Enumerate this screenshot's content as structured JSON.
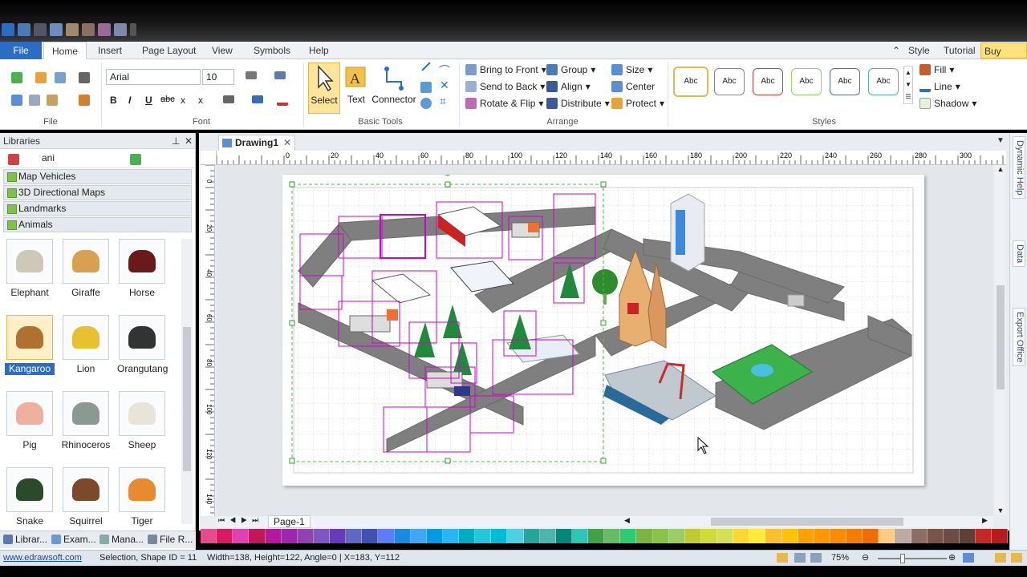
{
  "quick_access_icons": [
    "app-icon",
    "undo-icon",
    "redo-icon",
    "pointer-icon",
    "save-icon",
    "open-icon",
    "print-icon",
    "clipboard-icon",
    "menu-icon"
  ],
  "menu_tabs": {
    "file": "File",
    "home": "Home",
    "insert": "Insert",
    "page_layout": "Page Layout",
    "view": "View",
    "symbols": "Symbols",
    "help": "Help"
  },
  "top_right": {
    "style": "Style",
    "tutorial": "Tutorial",
    "buy_now": "Buy Now"
  },
  "ribbon": {
    "file_group": "File",
    "font": {
      "family": "Arial",
      "size": "10",
      "group": "Font",
      "bold": "B",
      "italic": "I",
      "underline": "U",
      "strike": "abc",
      "sub": "x",
      "sup": "x"
    },
    "basic_tools": {
      "select": "Select",
      "text": "Text",
      "connector": "Connector",
      "group": "Basic Tools"
    },
    "arrange": {
      "bring_to_front": "Bring to Front",
      "send_to_back": "Send to Back",
      "rotate_flip": "Rotate & Flip",
      "group_btn": "Group",
      "align": "Align",
      "distribute": "Distribute",
      "size": "Size",
      "center": "Center",
      "protect": "Protect",
      "group": "Arrange"
    },
    "styles": {
      "sample": "Abc",
      "group": "Styles",
      "fill": "Fill",
      "line": "Line",
      "shadow": "Shadow"
    }
  },
  "libraries": {
    "title": "Libraries",
    "search": "ani",
    "categories": [
      "Map Vehicles",
      "3D Directional Maps",
      "Landmarks",
      "Animals"
    ],
    "animals": [
      "Elephant",
      "Giraffe",
      "Horse",
      "Kangaroo",
      "Lion",
      "Orangutang",
      "Pig",
      "Rhinoceros",
      "Sheep",
      "Snake",
      "Squirrel",
      "Tiger"
    ],
    "selected": "Kangaroo",
    "bottom_tabs": [
      "Librar...",
      "Exam...",
      "Mana...",
      "File R..."
    ]
  },
  "document": {
    "tab": "Drawing1",
    "page": "Page-1",
    "ruler_labels": [
      "0",
      "20",
      "40",
      "60",
      "80",
      "100",
      "120",
      "140",
      "160",
      "180",
      "200",
      "220",
      "240",
      "260",
      "280",
      "300"
    ],
    "vruler_labels": [
      "0",
      "20",
      "40",
      "60",
      "80",
      "100",
      "120",
      "140"
    ]
  },
  "right_panel": [
    "Dynamic Help",
    "Data",
    "Export Office"
  ],
  "status": {
    "url": "www.edrawsoft.com",
    "selection": "Selection, Shape ID = 11",
    "dims": "Width=138, Height=122, Angle=0 | X=183, Y=112",
    "zoom": "75%"
  },
  "palette": [
    "#e84a8a",
    "#d81b60",
    "#e040b0",
    "#c2185b",
    "#b5179e",
    "#9c27b0",
    "#8e44ad",
    "#7e57c2",
    "#673ab7",
    "#5c6bc0",
    "#3f51b5",
    "#5c7cfa",
    "#1e88e5",
    "#42a5f5",
    "#039be5",
    "#29b6f6",
    "#00acc1",
    "#26c6da",
    "#00bcd4",
    "#4dd0e1",
    "#26a69a",
    "#4db6ac",
    "#00897b",
    "#2ec4b6",
    "#43a047",
    "#66bb6a",
    "#2ecc71",
    "#7cb342",
    "#8bc34a",
    "#9ccc65",
    "#c0ca33",
    "#cddc39",
    "#d4e157",
    "#fdd835",
    "#ffeb3b",
    "#fbc02d",
    "#ffc107",
    "#ffa000",
    "#ff9800",
    "#fb8c00",
    "#f57c00",
    "#ef6c00",
    "#ffcc80",
    "#bcaaa4",
    "#8d6e63",
    "#795548",
    "#6d4c41",
    "#5d4037",
    "#c62828",
    "#b71c1c"
  ]
}
